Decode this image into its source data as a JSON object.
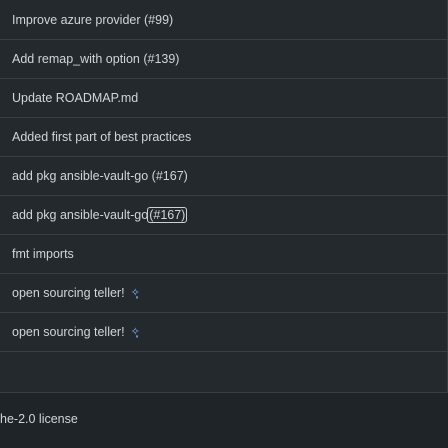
{
  "commits": [
    {
      "text": "Improve azure provider (#99)"
    },
    {
      "text": "Add remap_with option (#139)"
    },
    {
      "text": "Update ROADMAP.md"
    },
    {
      "text": "Added first part of best practices"
    },
    {
      "text": "add pkg ansible-vault-go (#167)"
    },
    {
      "text_before": "add pkg ansible-vault-go ",
      "issue_ref": "(#167)",
      "focused": true
    },
    {
      "text": "fmt imports"
    },
    {
      "text": "open sourcing teller! ",
      "emoji": "✧͓"
    },
    {
      "text": "open sourcing teller! ",
      "emoji": "✧͓"
    }
  ],
  "bottom": {
    "license_text": "he-2.0 license"
  },
  "colors": {
    "background": "#24292e",
    "bottom_background": "#1f2428",
    "text": "#d1d5da",
    "divider": "#3a3f45"
  }
}
